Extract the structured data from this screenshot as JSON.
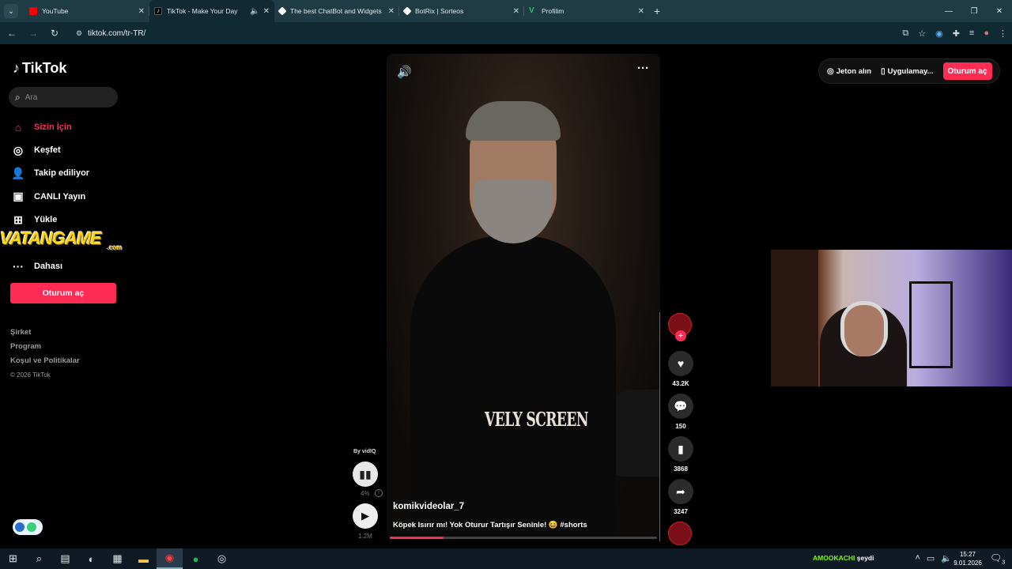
{
  "browser": {
    "tabs": [
      {
        "title": "YouTube",
        "color": "#ff0000"
      },
      {
        "title": "TikTok - Make Your Day",
        "color": "#000000"
      },
      {
        "title": "The best ChatBot and Widgets",
        "color": "#ffffff"
      },
      {
        "title": "BotRix | Sorteos",
        "color": "#ffffff"
      },
      {
        "title": "Profilim",
        "color": "#22c55e"
      }
    ],
    "url": "tiktok.com/tr-TR/"
  },
  "tiktok": {
    "logo_text": "TikTok",
    "search_placeholder": "Ara",
    "nav": [
      {
        "label": "Sizin İçin",
        "icon": "home-icon"
      },
      {
        "label": "Keşfet",
        "icon": "compass-icon"
      },
      {
        "label": "Takip ediliyor",
        "icon": "user-icon"
      },
      {
        "label": "CANLI Yayın",
        "icon": "live-icon"
      },
      {
        "label": "Yükle",
        "icon": "upload-icon"
      },
      {
        "label": "Dahası",
        "icon": "more-icon"
      }
    ],
    "sidebar_login": "Oturum aç",
    "footer": {
      "links": [
        "Şirket",
        "Program",
        "Koşul ve Politikalar"
      ],
      "copyright": "© 2026 TikTok"
    },
    "header": {
      "coins": "Jeton alın",
      "app": "Uygulamay...",
      "login": "Oturum aç"
    },
    "video": {
      "author": "komikvideolar_7",
      "caption": "Köpek Isırır mı! Yok Oturur Tartışır Seninle! 😆  #shorts",
      "watermark": "VELY SCREEN",
      "progress": 0.2
    },
    "actions": {
      "likes": "43.2K",
      "comments": "150",
      "saves": "3868",
      "shares": "3247"
    },
    "vidiq": {
      "label": "By vidIQ",
      "percent": "4%",
      "views": "1.2M"
    }
  },
  "overlay": {
    "brand": "VATANGAME",
    "brand_suffix": ".com"
  },
  "taskbar": {
    "chat_name": "AMOOKACHI",
    "chat_text": "şeydi",
    "time": "15:27",
    "date": "9.01.2026",
    "notification_count": "3"
  }
}
